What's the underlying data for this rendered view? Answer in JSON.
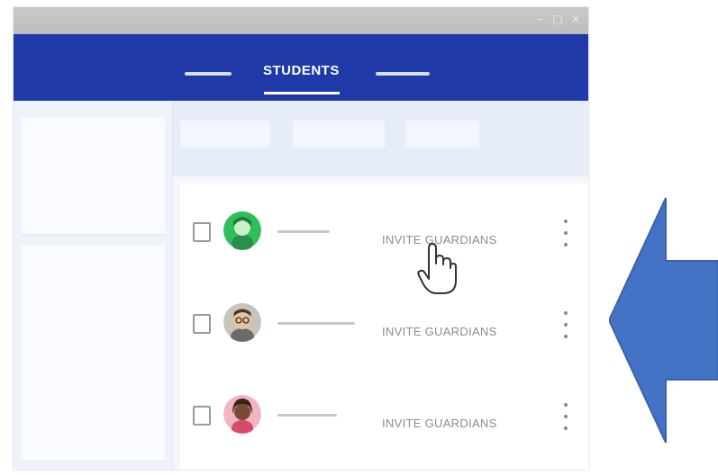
{
  "nav": {
    "title": "STUDENTS"
  },
  "students": [
    {
      "action_label": "INVITE GUARDIANS",
      "avatar": "student-avatar-green-icon"
    },
    {
      "action_label": "INVITE GUARDIANS",
      "avatar": "student-avatar-glasses-icon"
    },
    {
      "action_label": "INVITE GUARDIANS",
      "avatar": "student-avatar-pink-icon"
    }
  ],
  "colors": {
    "nav_bar": "#1f3aa8",
    "arrow": "#4472c4"
  },
  "icons": [
    "minimize-icon",
    "maximize-icon",
    "close-icon",
    "hand-cursor-icon",
    "left-arrow-icon",
    "kebab-menu-icon"
  ]
}
